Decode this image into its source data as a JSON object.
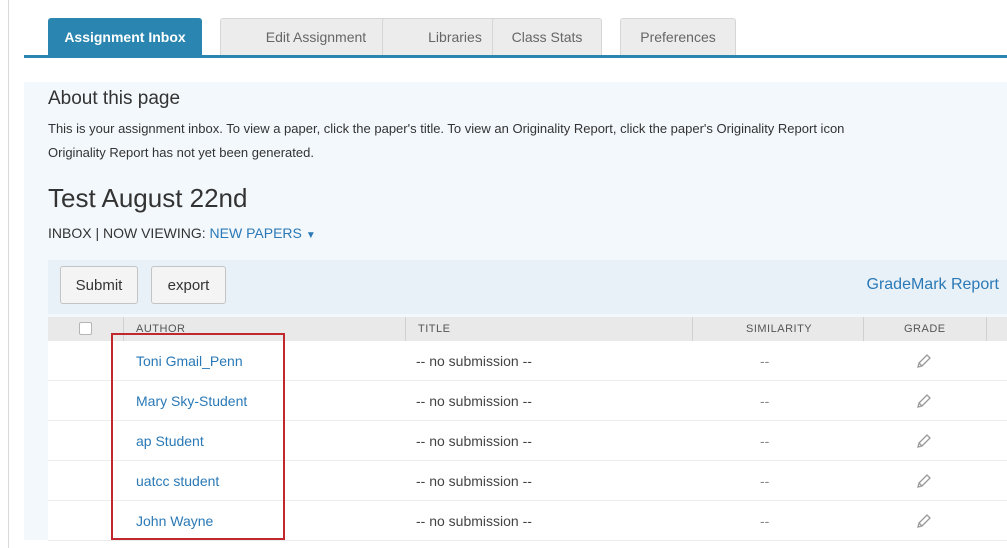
{
  "tabs": [
    {
      "label": "Assignment Inbox",
      "active": true
    },
    {
      "label": "Edit Assignment",
      "active": false
    },
    {
      "label": "Libraries",
      "active": false
    },
    {
      "label": "Class Stats",
      "active": false
    },
    {
      "label": "Preferences",
      "active": false
    }
  ],
  "about": {
    "title": "About this page",
    "line1": "This is your assignment inbox. To view a paper, click the paper's title. To view an Originality Report, click the paper's Originality Report icon",
    "line2": "Originality Report has not yet been generated."
  },
  "assignment": {
    "title": "Test August 22nd",
    "viewing_prefix": "INBOX | NOW VIEWING: ",
    "viewing_link": "NEW PAPERS",
    "caret": "▼"
  },
  "toolbar": {
    "submit_label": "Submit",
    "export_label": "export",
    "grademark_label": "GradeMark Report"
  },
  "table": {
    "headers": {
      "author": "AUTHOR",
      "title": "TITLE",
      "similarity": "SIMILARITY",
      "grade": "GRADE"
    },
    "rows": [
      {
        "author": "Toni Gmail_Penn",
        "title": "-- no submission --",
        "similarity": "--"
      },
      {
        "author": "Mary Sky-Student",
        "title": "-- no submission --",
        "similarity": "--"
      },
      {
        "author": "ap Student",
        "title": "-- no submission --",
        "similarity": "--"
      },
      {
        "author": "uatcc student",
        "title": "-- no submission --",
        "similarity": "--"
      },
      {
        "author": "John Wayne",
        "title": "-- no submission --",
        "similarity": "--"
      }
    ]
  },
  "icons": {
    "grade": "pencil-icon",
    "dropdown": "caret-down-icon"
  },
  "colors": {
    "accent": "#2a86b0",
    "link": "#2a79b6",
    "highlight": "#c0282e"
  }
}
